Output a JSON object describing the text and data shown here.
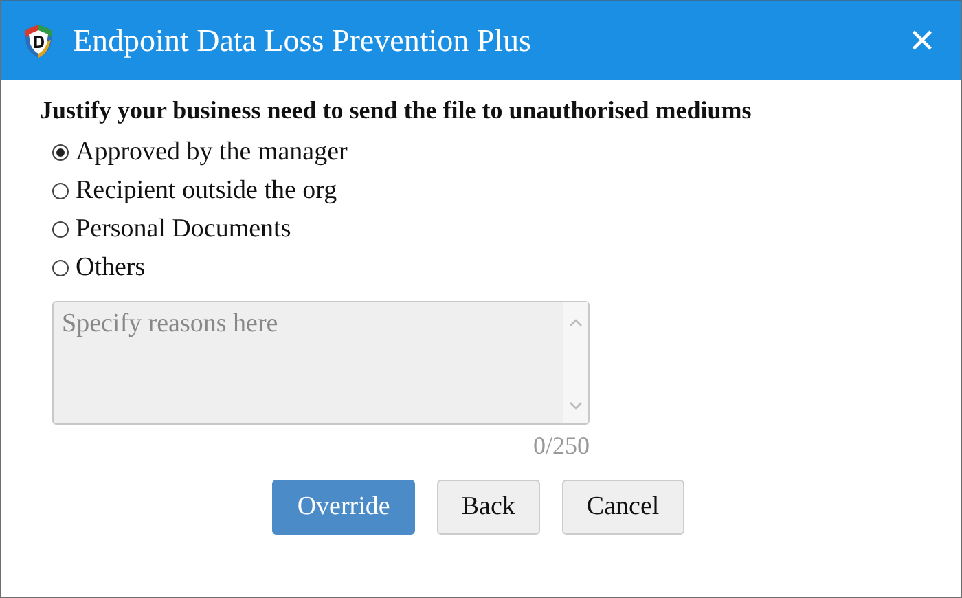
{
  "window": {
    "title": "Endpoint Data Loss Prevention Plus",
    "close": "✕"
  },
  "prompt": "Justify your business need to send the file to unauthorised mediums",
  "options": [
    {
      "label": "Approved by the manager",
      "selected": true
    },
    {
      "label": "Recipient outside the org",
      "selected": false
    },
    {
      "label": "Personal Documents",
      "selected": false
    },
    {
      "label": "Others",
      "selected": false
    }
  ],
  "reason": {
    "placeholder": "Specify reasons here",
    "disabled": true,
    "counter": "0/250"
  },
  "buttons": [
    {
      "label": "Override",
      "kind": "primary"
    },
    {
      "label": "Back",
      "kind": "secondary"
    },
    {
      "label": "Cancel",
      "kind": "secondary"
    }
  ]
}
